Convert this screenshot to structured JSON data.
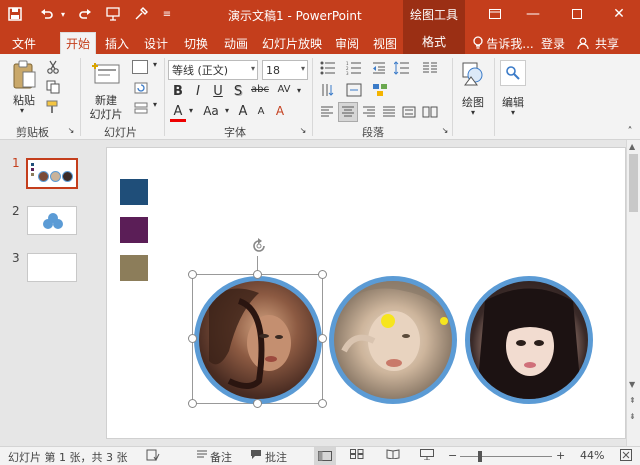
{
  "titlebar": {
    "title": "演示文稿1 - PowerPoint",
    "context_tool": "绘图工具",
    "icons": [
      "save-icon",
      "undo-icon",
      "redo-icon",
      "start-slideshow-icon",
      "eyedropper-icon",
      "customize-qat-icon"
    ]
  },
  "tabs": [
    {
      "label": "文件"
    },
    {
      "label": "开始"
    },
    {
      "label": "插入"
    },
    {
      "label": "设计"
    },
    {
      "label": "切换"
    },
    {
      "label": "动画"
    },
    {
      "label": "幻灯片放映"
    },
    {
      "label": "审阅"
    },
    {
      "label": "视图"
    },
    {
      "label": "格式"
    }
  ],
  "tabbar_right": {
    "tell_me": "告诉我...",
    "login": "登录",
    "share": "共享"
  },
  "ribbon": {
    "clipboard": {
      "paste": "粘贴",
      "group": "剪贴板"
    },
    "slides": {
      "new_slide_line1": "新建",
      "new_slide_line2": "幻灯片",
      "group": "幻灯片"
    },
    "font": {
      "font_name": "等线 (正文)",
      "font_size": "18",
      "group": "字体",
      "bold": "B",
      "italic": "I",
      "underline": "U",
      "shadow": "S",
      "strike": "abc",
      "spacing": "AV",
      "grow": "A",
      "shrink": "A",
      "clear": "A",
      "color": "A",
      "case": "Aa"
    },
    "paragraph": {
      "group": "段落"
    },
    "drawing": {
      "label": "绘图"
    },
    "editing": {
      "label": "编辑"
    }
  },
  "thumbnails": [
    {
      "num": "1"
    },
    {
      "num": "2"
    },
    {
      "num": "3"
    }
  ],
  "slide": {
    "colors": [
      "#1f4e79",
      "#5b1e57",
      "#8c7d5a"
    ],
    "ring_color": "#5b9bd5"
  },
  "statusbar": {
    "slide_info": "幻灯片 第 1 张，共 3 张",
    "notes": "备注",
    "comments": "批注",
    "zoom": "44%"
  }
}
